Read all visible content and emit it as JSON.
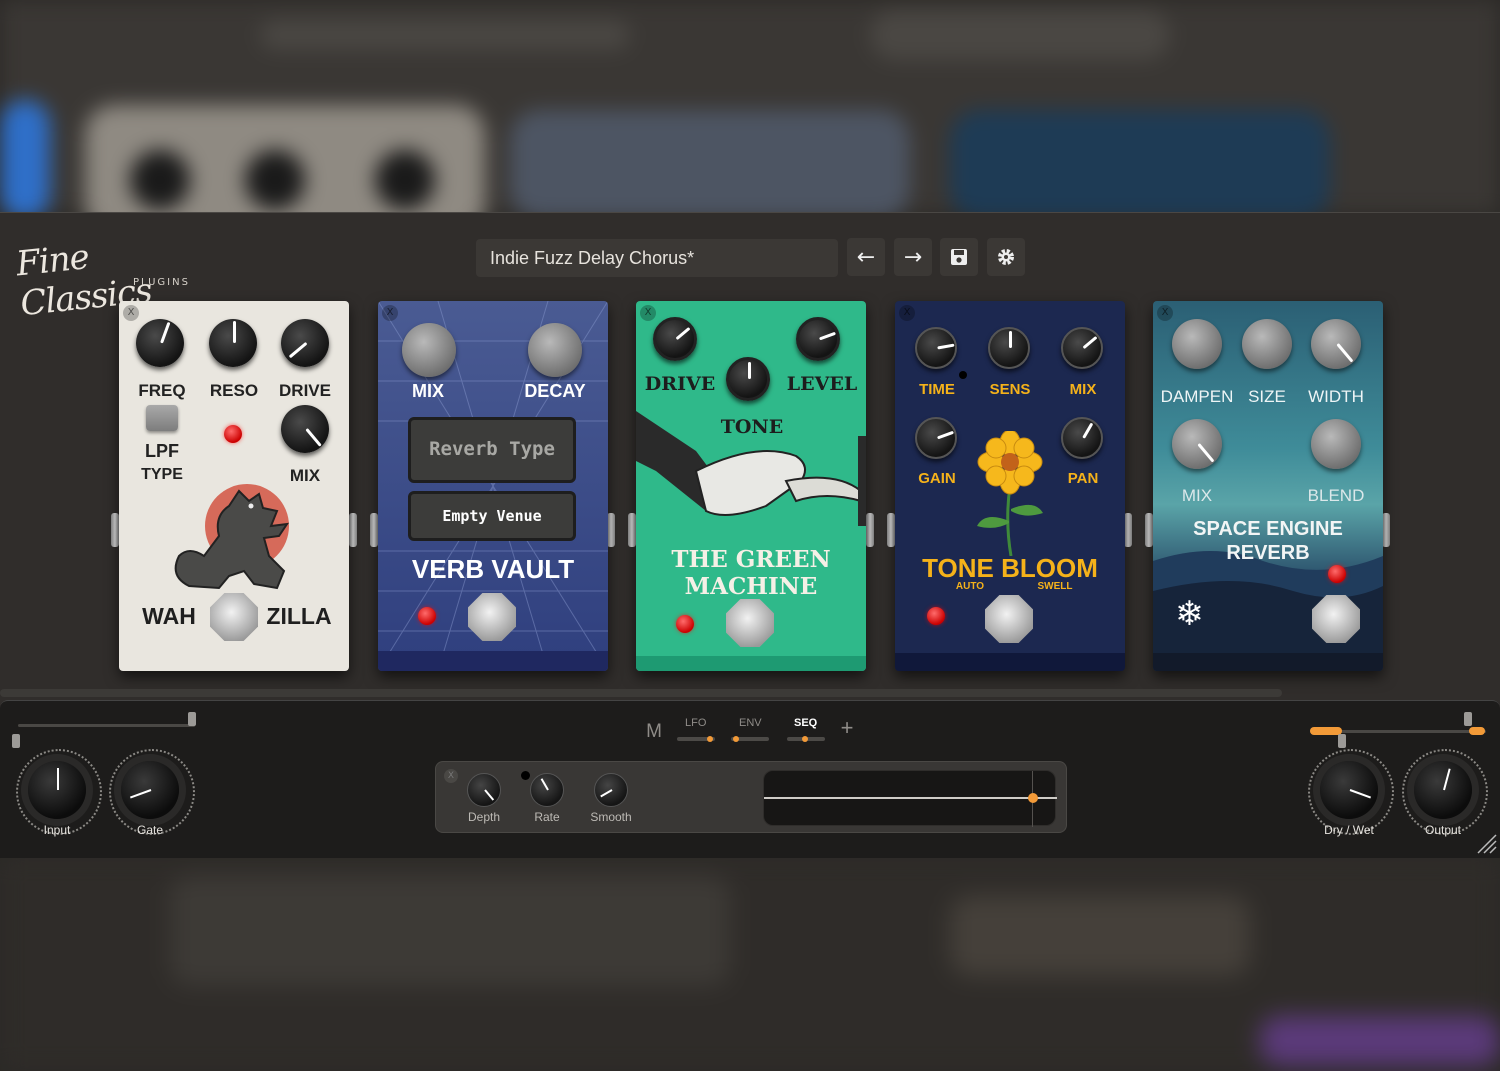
{
  "app": {
    "logo_main": "Fine Classics",
    "logo_sub": "PLUGINS",
    "preset_name": "Indie Fuzz Delay Chorus*"
  },
  "toolbar": {
    "prev_label": "←",
    "next_label": "→",
    "save_icon": "save-icon",
    "settings_icon": "gear-icon"
  },
  "pedals": [
    {
      "name_left": "WAH",
      "name_right": "ZILLA",
      "knobs": [
        "FREQ",
        "RESO",
        "DRIVE",
        "MIX"
      ],
      "switch_label": "LPF",
      "switch_sub": "TYPE",
      "color": "#e9e6df"
    },
    {
      "name": "VERB VAULT",
      "knobs": [
        "MIX",
        "DECAY"
      ],
      "display_title": "Reverb Type",
      "display_value": "Empty Venue",
      "color": "#3a4b8a"
    },
    {
      "name_line1": "THE GREEN",
      "name_line2": "MACHINE",
      "knobs": [
        "DRIVE",
        "TONE",
        "LEVEL"
      ],
      "color": "#2fb98a"
    },
    {
      "name": "TONE BLOOM",
      "sub_left": "AUTO",
      "sub_right": "SWELL",
      "knobs": [
        "TIME",
        "SENS",
        "MIX",
        "GAIN",
        "PAN"
      ],
      "color": "#1c2850"
    },
    {
      "name_line1": "SPACE ENGINE",
      "name_line2": "REVERB",
      "knobs": [
        "DAMPEN",
        "SIZE",
        "WIDTH",
        "MIX",
        "BLEND"
      ],
      "color": "#2a6f80"
    }
  ],
  "strip": {
    "input_label": "Input",
    "gate_label": "Gate",
    "drywet_label": "Dry / Wet",
    "output_label": "Output",
    "mod_header": "M",
    "mod_tabs": [
      "LFO",
      "ENV",
      "SEQ"
    ],
    "active_tab": "SEQ",
    "add_label": "+",
    "mod_knobs": [
      "Depth",
      "Rate",
      "Smooth"
    ],
    "accent": "#f29a38"
  }
}
